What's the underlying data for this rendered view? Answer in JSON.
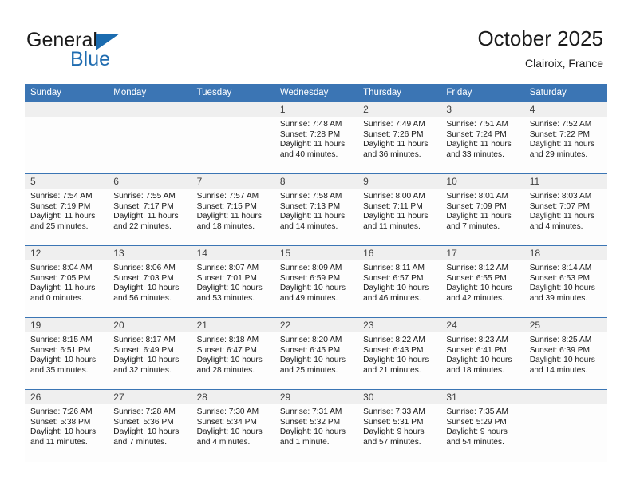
{
  "logo": {
    "word_one": "General",
    "word_two": "Blue",
    "mark": "triangle-flag",
    "accent_color": "#1f6cb0"
  },
  "header": {
    "title": "October 2025",
    "subtitle": "Clairoix, France"
  },
  "theme": {
    "header_blue": "#3b75b4",
    "daynum_gray": "#efefef",
    "cell_white": "#fdfdfd"
  },
  "weekdays": [
    "Sunday",
    "Monday",
    "Tuesday",
    "Wednesday",
    "Thursday",
    "Friday",
    "Saturday"
  ],
  "labels": {
    "sunrise": "Sunrise:",
    "sunset": "Sunset:",
    "daylight": "Daylight:"
  },
  "weeks": [
    [
      {
        "day": "",
        "sunrise": "",
        "sunset": "",
        "daylight_a": "",
        "daylight_b": ""
      },
      {
        "day": "",
        "sunrise": "",
        "sunset": "",
        "daylight_a": "",
        "daylight_b": ""
      },
      {
        "day": "",
        "sunrise": "",
        "sunset": "",
        "daylight_a": "",
        "daylight_b": ""
      },
      {
        "day": "1",
        "sunrise": "Sunrise: 7:48 AM",
        "sunset": "Sunset: 7:28 PM",
        "daylight_a": "Daylight: 11 hours",
        "daylight_b": "and 40 minutes."
      },
      {
        "day": "2",
        "sunrise": "Sunrise: 7:49 AM",
        "sunset": "Sunset: 7:26 PM",
        "daylight_a": "Daylight: 11 hours",
        "daylight_b": "and 36 minutes."
      },
      {
        "day": "3",
        "sunrise": "Sunrise: 7:51 AM",
        "sunset": "Sunset: 7:24 PM",
        "daylight_a": "Daylight: 11 hours",
        "daylight_b": "and 33 minutes."
      },
      {
        "day": "4",
        "sunrise": "Sunrise: 7:52 AM",
        "sunset": "Sunset: 7:22 PM",
        "daylight_a": "Daylight: 11 hours",
        "daylight_b": "and 29 minutes."
      }
    ],
    [
      {
        "day": "5",
        "sunrise": "Sunrise: 7:54 AM",
        "sunset": "Sunset: 7:19 PM",
        "daylight_a": "Daylight: 11 hours",
        "daylight_b": "and 25 minutes."
      },
      {
        "day": "6",
        "sunrise": "Sunrise: 7:55 AM",
        "sunset": "Sunset: 7:17 PM",
        "daylight_a": "Daylight: 11 hours",
        "daylight_b": "and 22 minutes."
      },
      {
        "day": "7",
        "sunrise": "Sunrise: 7:57 AM",
        "sunset": "Sunset: 7:15 PM",
        "daylight_a": "Daylight: 11 hours",
        "daylight_b": "and 18 minutes."
      },
      {
        "day": "8",
        "sunrise": "Sunrise: 7:58 AM",
        "sunset": "Sunset: 7:13 PM",
        "daylight_a": "Daylight: 11 hours",
        "daylight_b": "and 14 minutes."
      },
      {
        "day": "9",
        "sunrise": "Sunrise: 8:00 AM",
        "sunset": "Sunset: 7:11 PM",
        "daylight_a": "Daylight: 11 hours",
        "daylight_b": "and 11 minutes."
      },
      {
        "day": "10",
        "sunrise": "Sunrise: 8:01 AM",
        "sunset": "Sunset: 7:09 PM",
        "daylight_a": "Daylight: 11 hours",
        "daylight_b": "and 7 minutes."
      },
      {
        "day": "11",
        "sunrise": "Sunrise: 8:03 AM",
        "sunset": "Sunset: 7:07 PM",
        "daylight_a": "Daylight: 11 hours",
        "daylight_b": "and 4 minutes."
      }
    ],
    [
      {
        "day": "12",
        "sunrise": "Sunrise: 8:04 AM",
        "sunset": "Sunset: 7:05 PM",
        "daylight_a": "Daylight: 11 hours",
        "daylight_b": "and 0 minutes."
      },
      {
        "day": "13",
        "sunrise": "Sunrise: 8:06 AM",
        "sunset": "Sunset: 7:03 PM",
        "daylight_a": "Daylight: 10 hours",
        "daylight_b": "and 56 minutes."
      },
      {
        "day": "14",
        "sunrise": "Sunrise: 8:07 AM",
        "sunset": "Sunset: 7:01 PM",
        "daylight_a": "Daylight: 10 hours",
        "daylight_b": "and 53 minutes."
      },
      {
        "day": "15",
        "sunrise": "Sunrise: 8:09 AM",
        "sunset": "Sunset: 6:59 PM",
        "daylight_a": "Daylight: 10 hours",
        "daylight_b": "and 49 minutes."
      },
      {
        "day": "16",
        "sunrise": "Sunrise: 8:11 AM",
        "sunset": "Sunset: 6:57 PM",
        "daylight_a": "Daylight: 10 hours",
        "daylight_b": "and 46 minutes."
      },
      {
        "day": "17",
        "sunrise": "Sunrise: 8:12 AM",
        "sunset": "Sunset: 6:55 PM",
        "daylight_a": "Daylight: 10 hours",
        "daylight_b": "and 42 minutes."
      },
      {
        "day": "18",
        "sunrise": "Sunrise: 8:14 AM",
        "sunset": "Sunset: 6:53 PM",
        "daylight_a": "Daylight: 10 hours",
        "daylight_b": "and 39 minutes."
      }
    ],
    [
      {
        "day": "19",
        "sunrise": "Sunrise: 8:15 AM",
        "sunset": "Sunset: 6:51 PM",
        "daylight_a": "Daylight: 10 hours",
        "daylight_b": "and 35 minutes."
      },
      {
        "day": "20",
        "sunrise": "Sunrise: 8:17 AM",
        "sunset": "Sunset: 6:49 PM",
        "daylight_a": "Daylight: 10 hours",
        "daylight_b": "and 32 minutes."
      },
      {
        "day": "21",
        "sunrise": "Sunrise: 8:18 AM",
        "sunset": "Sunset: 6:47 PM",
        "daylight_a": "Daylight: 10 hours",
        "daylight_b": "and 28 minutes."
      },
      {
        "day": "22",
        "sunrise": "Sunrise: 8:20 AM",
        "sunset": "Sunset: 6:45 PM",
        "daylight_a": "Daylight: 10 hours",
        "daylight_b": "and 25 minutes."
      },
      {
        "day": "23",
        "sunrise": "Sunrise: 8:22 AM",
        "sunset": "Sunset: 6:43 PM",
        "daylight_a": "Daylight: 10 hours",
        "daylight_b": "and 21 minutes."
      },
      {
        "day": "24",
        "sunrise": "Sunrise: 8:23 AM",
        "sunset": "Sunset: 6:41 PM",
        "daylight_a": "Daylight: 10 hours",
        "daylight_b": "and 18 minutes."
      },
      {
        "day": "25",
        "sunrise": "Sunrise: 8:25 AM",
        "sunset": "Sunset: 6:39 PM",
        "daylight_a": "Daylight: 10 hours",
        "daylight_b": "and 14 minutes."
      }
    ],
    [
      {
        "day": "26",
        "sunrise": "Sunrise: 7:26 AM",
        "sunset": "Sunset: 5:38 PM",
        "daylight_a": "Daylight: 10 hours",
        "daylight_b": "and 11 minutes."
      },
      {
        "day": "27",
        "sunrise": "Sunrise: 7:28 AM",
        "sunset": "Sunset: 5:36 PM",
        "daylight_a": "Daylight: 10 hours",
        "daylight_b": "and 7 minutes."
      },
      {
        "day": "28",
        "sunrise": "Sunrise: 7:30 AM",
        "sunset": "Sunset: 5:34 PM",
        "daylight_a": "Daylight: 10 hours",
        "daylight_b": "and 4 minutes."
      },
      {
        "day": "29",
        "sunrise": "Sunrise: 7:31 AM",
        "sunset": "Sunset: 5:32 PM",
        "daylight_a": "Daylight: 10 hours",
        "daylight_b": "and 1 minute."
      },
      {
        "day": "30",
        "sunrise": "Sunrise: 7:33 AM",
        "sunset": "Sunset: 5:31 PM",
        "daylight_a": "Daylight: 9 hours",
        "daylight_b": "and 57 minutes."
      },
      {
        "day": "31",
        "sunrise": "Sunrise: 7:35 AM",
        "sunset": "Sunset: 5:29 PM",
        "daylight_a": "Daylight: 9 hours",
        "daylight_b": "and 54 minutes."
      },
      {
        "day": "",
        "sunrise": "",
        "sunset": "",
        "daylight_a": "",
        "daylight_b": ""
      }
    ]
  ]
}
